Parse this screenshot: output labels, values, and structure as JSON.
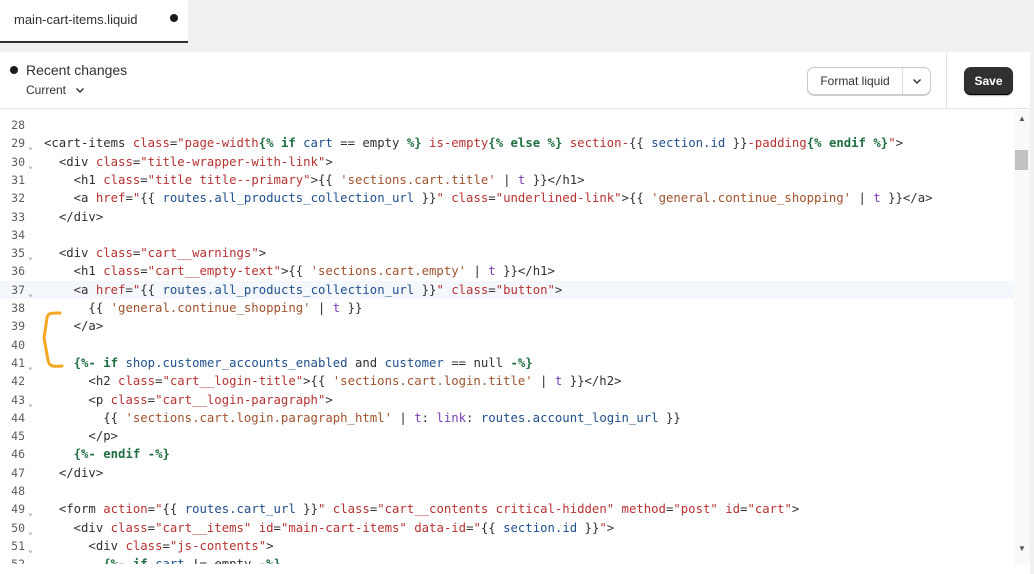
{
  "tab": {
    "label": "main-cart-items.liquid",
    "unsaved": true
  },
  "toolbar": {
    "recent_changes": "Recent changes",
    "version_select": "Current",
    "format_label": "Format liquid",
    "save_label": "Save"
  },
  "editor": {
    "active_line": 37,
    "lines": [
      {
        "n": "28",
        "fold": false,
        "code": ""
      },
      {
        "n": "29",
        "fold": true,
        "code": "<cart-items class=\"page-width{% if cart == empty %} is-empty{% else %} section-{{ section.id }}-padding{% endif %}\">"
      },
      {
        "n": "30",
        "fold": true,
        "code": "  <div class=\"title-wrapper-with-link\">"
      },
      {
        "n": "31",
        "fold": false,
        "code": "    <h1 class=\"title title--primary\">{{ 'sections.cart.title' | t }}</h1>"
      },
      {
        "n": "32",
        "fold": false,
        "code": "    <a href=\"{{ routes.all_products_collection_url }}\" class=\"underlined-link\">{{ 'general.continue_shopping' | t }}</a>"
      },
      {
        "n": "33",
        "fold": false,
        "code": "  </div>"
      },
      {
        "n": "34",
        "fold": false,
        "code": ""
      },
      {
        "n": "35",
        "fold": true,
        "code": "  <div class=\"cart__warnings\">"
      },
      {
        "n": "36",
        "fold": false,
        "code": "    <h1 class=\"cart__empty-text\">{{ 'sections.cart.empty' | t }}</h1>"
      },
      {
        "n": "37",
        "fold": true,
        "code": "    <a href=\"{{ routes.all_products_collection_url }}\" class=\"button\">"
      },
      {
        "n": "38",
        "fold": false,
        "code": "      {{ 'general.continue_shopping' | t }}"
      },
      {
        "n": "39",
        "fold": false,
        "code": "    </a>"
      },
      {
        "n": "40",
        "fold": false,
        "code": ""
      },
      {
        "n": "41",
        "fold": true,
        "code": "    {%- if shop.customer_accounts_enabled and customer == null -%}"
      },
      {
        "n": "42",
        "fold": false,
        "code": "      <h2 class=\"cart__login-title\">{{ 'sections.cart.login.title' | t }}</h2>"
      },
      {
        "n": "43",
        "fold": true,
        "code": "      <p class=\"cart__login-paragraph\">"
      },
      {
        "n": "44",
        "fold": false,
        "code": "        {{ 'sections.cart.login.paragraph_html' | t: link: routes.account_login_url }}"
      },
      {
        "n": "45",
        "fold": false,
        "code": "      </p>"
      },
      {
        "n": "46",
        "fold": false,
        "code": "    {%- endif -%}"
      },
      {
        "n": "47",
        "fold": false,
        "code": "  </div>"
      },
      {
        "n": "48",
        "fold": false,
        "code": ""
      },
      {
        "n": "49",
        "fold": true,
        "code": "  <form action=\"{{ routes.cart_url }}\" class=\"cart__contents critical-hidden\" method=\"post\" id=\"cart\">"
      },
      {
        "n": "50",
        "fold": true,
        "code": "    <div class=\"cart__items\" id=\"main-cart-items\" data-id=\"{{ section.id }}\">"
      },
      {
        "n": "51",
        "fold": true,
        "code": "      <div class=\"js-contents\">"
      },
      {
        "n": "52",
        "fold": false,
        "code": "        {%- if cart != empty -%}"
      }
    ]
  },
  "colors": {
    "annotation": "#f5a623",
    "save_bg": "#303030",
    "attr": "#b83232",
    "keyword": "#1f6f42",
    "variable": "#1f4f8c",
    "filter": "#7a3db8",
    "liquid_string": "#a0522d"
  }
}
